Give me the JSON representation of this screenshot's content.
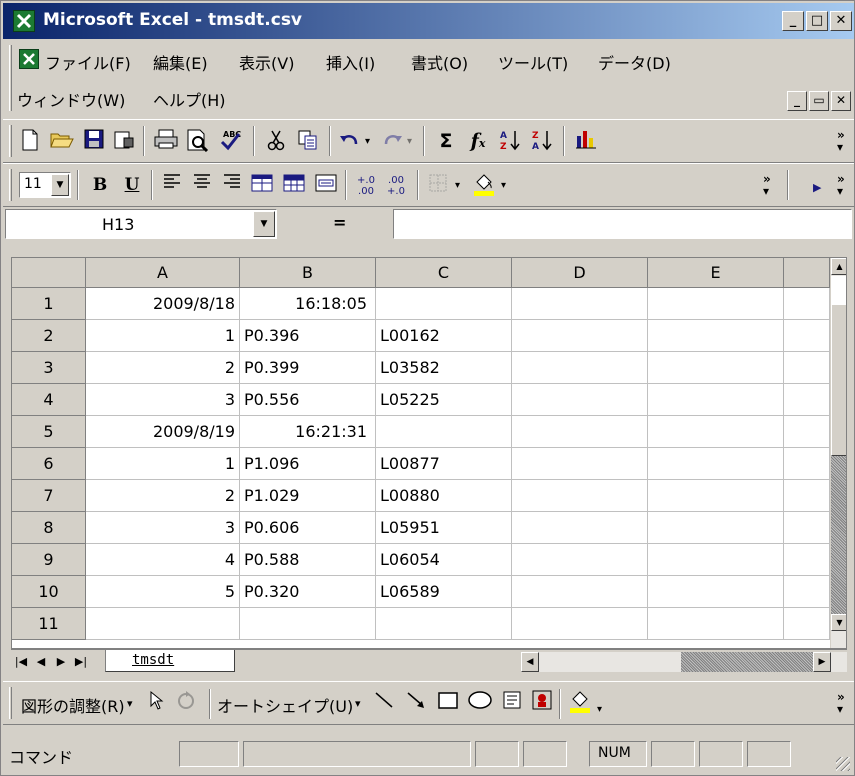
{
  "window": {
    "title": "Microsoft Excel - tmsdt.csv",
    "minimize": "_",
    "restore": "□",
    "close": "✕"
  },
  "menu": {
    "items": [
      "ファイル(F)",
      "編集(E)",
      "表示(V)",
      "挿入(I)",
      "書式(O)",
      "ツール(T)",
      "データ(D)",
      "ウィンドウ(W)",
      "ヘルプ(H)"
    ]
  },
  "toolbar_standard": {
    "icons": [
      "new-icon",
      "open-icon",
      "save-icon",
      "permission-icon",
      "print-icon",
      "print-preview-icon",
      "spelling-icon",
      "cut-icon",
      "copy-icon",
      "undo-icon",
      "redo-icon",
      "autosum-icon",
      "function-icon",
      "sort-ascending-icon",
      "sort-descending-icon",
      "chart-icon"
    ]
  },
  "toolbar_format": {
    "font_size": "11",
    "bold": "B",
    "underline": "U",
    "fill_color": "#ffff00"
  },
  "formula_bar": {
    "name_box": "H13",
    "equals": "=",
    "formula": ""
  },
  "sheet": {
    "columns": [
      "A",
      "B",
      "C",
      "D",
      "E"
    ],
    "rows": [
      {
        "n": "1",
        "a": "2009/8/18",
        "b": "16:18:05",
        "c": ""
      },
      {
        "n": "2",
        "a": "1",
        "b": "P0.396",
        "c": "L00162"
      },
      {
        "n": "3",
        "a": "2",
        "b": "P0.399",
        "c": "L03582"
      },
      {
        "n": "4",
        "a": "3",
        "b": "P0.556",
        "c": "L05225"
      },
      {
        "n": "5",
        "a": "2009/8/19",
        "b": "16:21:31",
        "c": ""
      },
      {
        "n": "6",
        "a": "1",
        "b": "P1.096",
        "c": "L00877"
      },
      {
        "n": "7",
        "a": "2",
        "b": "P1.029",
        "c": "L00880"
      },
      {
        "n": "8",
        "a": "3",
        "b": "P0.606",
        "c": "L05951"
      },
      {
        "n": "9",
        "a": "4",
        "b": "P0.588",
        "c": "L06054"
      },
      {
        "n": "10",
        "a": "5",
        "b": "P0.320",
        "c": "L06589"
      },
      {
        "n": "11",
        "a": "",
        "b": "",
        "c": ""
      }
    ],
    "tab_name": "tmsdt"
  },
  "drawing_toolbar": {
    "draw_menu": "図形の調整(R)",
    "autoshapes": "オートシェイプ(U)"
  },
  "status": {
    "text": "コマンド",
    "num": "NUM"
  }
}
